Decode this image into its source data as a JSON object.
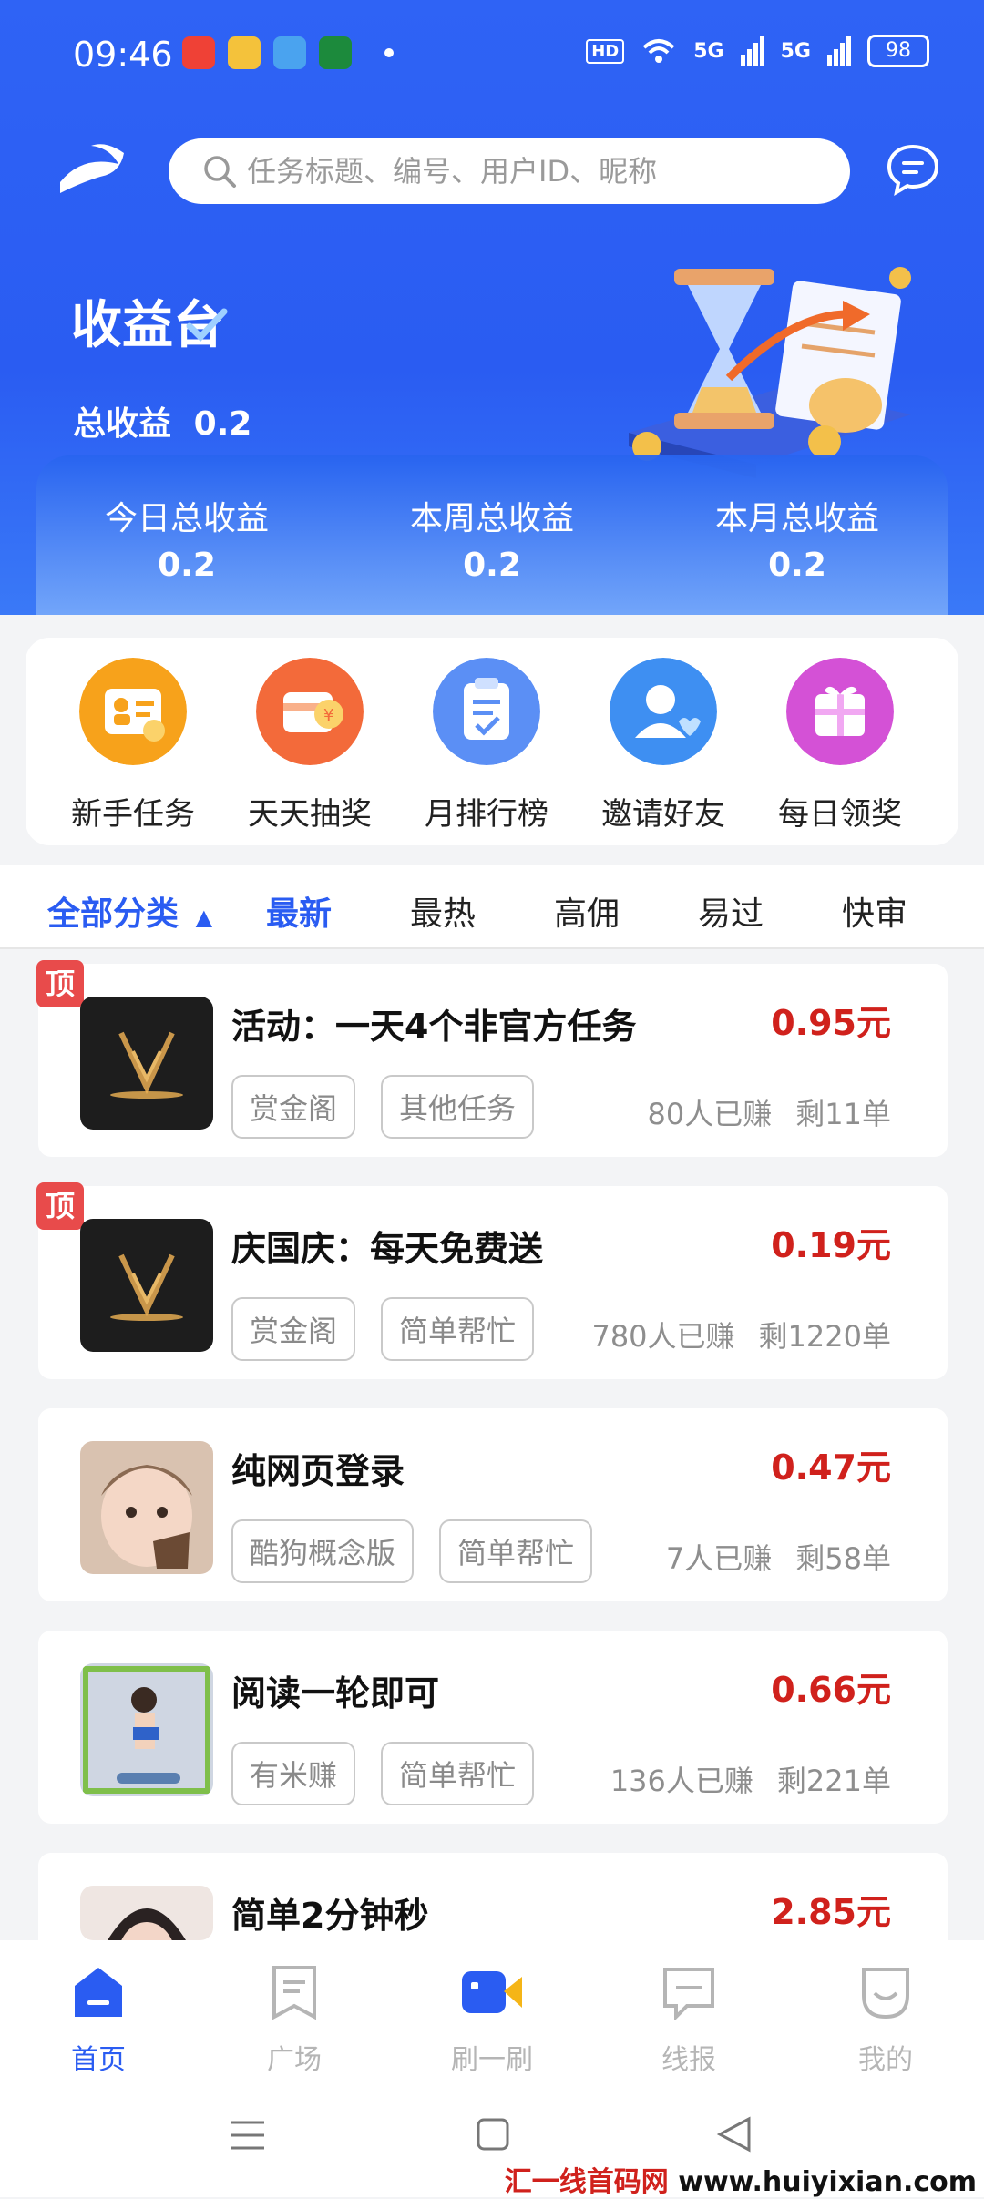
{
  "status_bar": {
    "time": "09:46",
    "hd_label": "HD",
    "net1": "5G",
    "net2": "5G",
    "battery": "98"
  },
  "header": {
    "search_placeholder": "任务标题、编号、用户ID、昵称"
  },
  "earnings": {
    "title": "收益台",
    "total_label": "总收益",
    "total_value": "0.2",
    "stats": [
      {
        "label": "今日总收益",
        "value": "0.2"
      },
      {
        "label": "本周总收益",
        "value": "0.2"
      },
      {
        "label": "本月总收益",
        "value": "0.2"
      }
    ]
  },
  "quick_entries": [
    {
      "label": "新手任务",
      "icon": "newbie-task-icon",
      "color": "#f7a21b"
    },
    {
      "label": "天天抽奖",
      "icon": "lottery-icon",
      "color": "#f36a3a"
    },
    {
      "label": "月排行榜",
      "icon": "ranking-icon",
      "color": "#5b8ff5"
    },
    {
      "label": "邀请好友",
      "icon": "invite-friend-icon",
      "color": "#3e8ff2"
    },
    {
      "label": "每日领奖",
      "icon": "daily-reward-icon",
      "color": "#d451d6"
    }
  ],
  "filter_tabs": {
    "all": "全部分类",
    "items": [
      "最新",
      "最热",
      "高佣",
      "易过",
      "快审"
    ]
  },
  "tasks": [
    {
      "pinned": true,
      "pin_label": "顶",
      "title": "活动：一天4个非官方任务",
      "price": "0.95元",
      "tags": [
        "赏金阁",
        "其他任务"
      ],
      "earned": "80人已赚",
      "remaining": "剩11单"
    },
    {
      "pinned": true,
      "pin_label": "顶",
      "title": "庆国庆：每天免费送",
      "price": "0.19元",
      "tags": [
        "赏金阁",
        "简单帮忙"
      ],
      "earned": "780人已赚",
      "remaining": "剩1220单"
    },
    {
      "pinned": false,
      "title": "纯网页登录",
      "price": "0.47元",
      "tags": [
        "酷狗概念版",
        "简单帮忙"
      ],
      "earned": "7人已赚",
      "remaining": "剩58单"
    },
    {
      "pinned": false,
      "title": "阅读一轮即可",
      "price": "0.66元",
      "tags": [
        "有米赚",
        "简单帮忙"
      ],
      "earned": "136人已赚",
      "remaining": "剩221单"
    },
    {
      "pinned": false,
      "title": "简单2分钟秒",
      "price": "2.85元"
    }
  ],
  "bottom_nav": [
    {
      "label": "首页",
      "icon": "home-icon",
      "active": true
    },
    {
      "label": "广场",
      "icon": "square-bookmark-icon",
      "active": false
    },
    {
      "label": "刷一刷",
      "icon": "video-icon",
      "active": false
    },
    {
      "label": "线报",
      "icon": "message-board-icon",
      "active": false
    },
    {
      "label": "我的",
      "icon": "profile-face-icon",
      "active": false
    }
  ],
  "watermark": {
    "part1": "汇一线首码网",
    "part2": "www.huiyixian.com"
  },
  "colors": {
    "primary": "#2a5cf2",
    "price": "#d0211c",
    "pin": "#e84b4b"
  }
}
